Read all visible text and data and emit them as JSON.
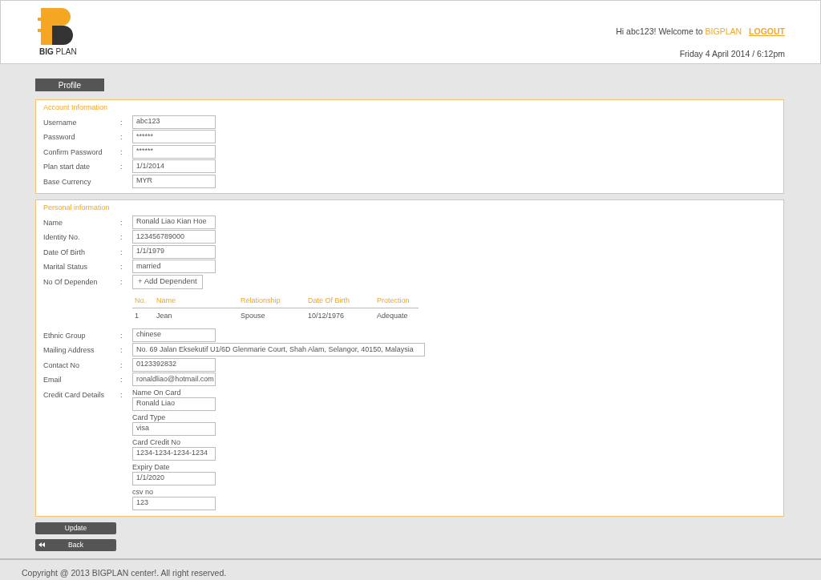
{
  "header": {
    "logo_text": "**BIG** PLAN",
    "greeting": "Hi abc123! Welcome to ",
    "brand": "BIGPLAN",
    "logout": "LOGOUT",
    "datetime": "Friday 4 April 2014 / 6:12pm"
  },
  "tab": {
    "label": "Profile",
    "selected": true
  },
  "sections": [
    {
      "title": "Account Information",
      "fields": [
        {
          "kind": "input",
          "label": "Username",
          "colon": ":",
          "value": "abc123"
        },
        {
          "kind": "input",
          "label": "Password",
          "colon": ":",
          "value": "******"
        },
        {
          "kind": "input",
          "label": "Confirm Password",
          "colon": ":",
          "value": "******"
        },
        {
          "kind": "input",
          "label": "Plan start date",
          "colon": ":",
          "value": "1/1/2014"
        },
        {
          "kind": "input",
          "label": "Base Currency",
          "value": "MYR"
        }
      ]
    },
    {
      "title": "Personal information",
      "fields": [
        {
          "kind": "input",
          "label": "Name",
          "colon": ":",
          "value": "Ronald Liao Kian Hoe"
        },
        {
          "kind": "input",
          "label": "Identity No.",
          "colon": ":",
          "value": "123456789000"
        },
        {
          "kind": "input",
          "label": "Date Of Birth",
          "colon": ":",
          "value": "1/1/1979"
        },
        {
          "kind": "input",
          "label": "Marital Status",
          "colon": ":",
          "value": "married"
        },
        {
          "kind": "dependents",
          "label": "No Of Dependen",
          "colon": ":",
          "button": "+ Add Dependent",
          "columns": [
            "No.",
            "Name",
            "Relationship",
            "Date Of Birth",
            "Protection"
          ],
          "rows": [
            [
              "1",
              "Jean",
              "Spouse",
              "10/12/1976",
              "Adequate"
            ]
          ]
        },
        {
          "kind": "input",
          "label": "Ethnic Group",
          "colon": ":",
          "value": "chinese"
        },
        {
          "kind": "wide-input",
          "label": "Mailing Address",
          "colon": ":",
          "value": "No. 69 Jalan Eksekutif U1/6D Glenmarie Court, Shah Alam, Selangor, 40150, Malaysia"
        },
        {
          "kind": "input",
          "label": "Contact No",
          "colon": ":",
          "value": "0123392832"
        },
        {
          "kind": "input",
          "label": "Email",
          "colon": ":",
          "value": "ronaldliao@hotmail.com"
        },
        {
          "kind": "card",
          "label": "Credit Card Details",
          "colon": ":",
          "subfields": [
            {
              "label": "Name On Card",
              "value": "Ronald Liao"
            },
            {
              "label": "Card Type",
              "value": "visa"
            },
            {
              "label": "Card Credit No",
              "value": "1234-1234-1234-1234"
            },
            {
              "label": "Expiry Date",
              "value": "1/1/2020"
            },
            {
              "label": "csv no",
              "value": "123"
            }
          ]
        }
      ]
    }
  ],
  "buttons": [
    {
      "kind": "update",
      "label": "Update"
    },
    {
      "kind": "back",
      "label": "Back"
    }
  ],
  "footer": "Copyright @ 2013 BIGPLAN center!. All right reserved."
}
